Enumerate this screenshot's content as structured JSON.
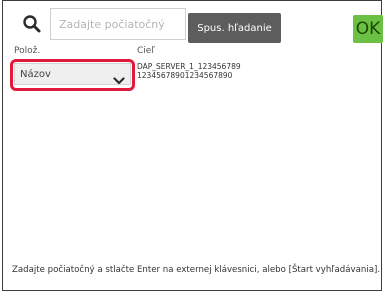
{
  "search": {
    "placeholder": "Zadajte počiatočný",
    "start_label": "Spus. hľadanie"
  },
  "ok_label": "OK",
  "columns": {
    "item_label": "Polož.",
    "target_label": "Cieľ"
  },
  "item_select": {
    "selected": "Názov"
  },
  "target": {
    "line1": "DAP_SERVER_1_123456789",
    "line2": "12345678901234567890"
  },
  "hint": "Zadajte počiatočný a stlačte Enter na externej klávesnici, alebo [Štart vyhľadávania].",
  "colors": {
    "accent_ok": "#6cc043",
    "highlight_frame": "#e3193c",
    "start_button": "#5d5d5d"
  },
  "icons": [
    "search-icon",
    "chevron-down-icon"
  ]
}
